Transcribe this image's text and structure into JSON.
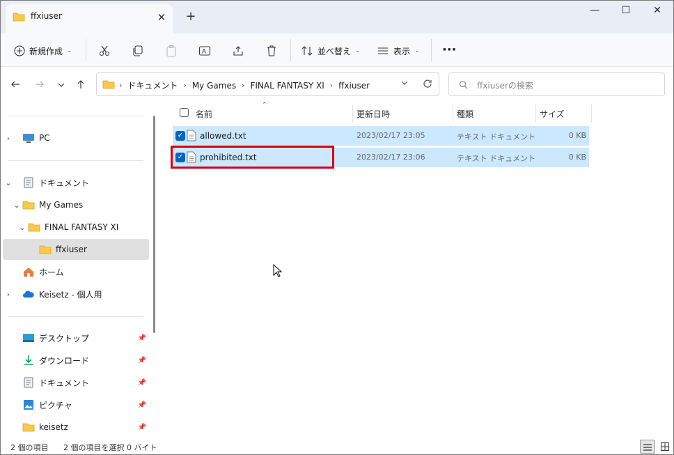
{
  "window": {
    "tab_title": "ffxiuser",
    "new_tab": "+",
    "close_tab": "✕",
    "minimize": "—",
    "maximize": "☐",
    "close": "✕"
  },
  "toolbar": {
    "new_label": "新規作成",
    "sort_label": "並べ替え",
    "view_label": "表示",
    "more": "···"
  },
  "address": {
    "crumbs": [
      "ドキュメント",
      "My Games",
      "FINAL FANTASY XI",
      "ffxiuser"
    ]
  },
  "search": {
    "placeholder": "ffxiuserの検索"
  },
  "navpane": {
    "pc": "PC",
    "documents": "ドキュメント",
    "my_games": "My Games",
    "ffxi": "FINAL FANTASY XI",
    "ffxiuser": "ffxiuser",
    "home": "ホーム",
    "onedrive": "Keisetz - 個人用",
    "desktop": "デスクトップ",
    "downloads": "ダウンロード",
    "documents2": "ドキュメント",
    "pictures": "ピクチャ",
    "keisetz": "keisetz"
  },
  "columns": {
    "name": "名前",
    "modified": "更新日時",
    "type": "種類",
    "size": "サイズ"
  },
  "files": [
    {
      "name": "allowed.txt",
      "modified": "2023/02/17 23:05",
      "type": "テキスト ドキュメント",
      "size": "0 KB"
    },
    {
      "name": "prohibited.txt",
      "modified": "2023/02/17 23:06",
      "type": "テキスト ドキュメント",
      "size": "0 KB"
    }
  ],
  "status": {
    "count": "2 個の項目",
    "selected": "2 個の項目を選択 0 バイト"
  },
  "colors": {
    "selection": "#cce8ff",
    "highlight": "#d8000c",
    "accent": "#0067c0"
  }
}
